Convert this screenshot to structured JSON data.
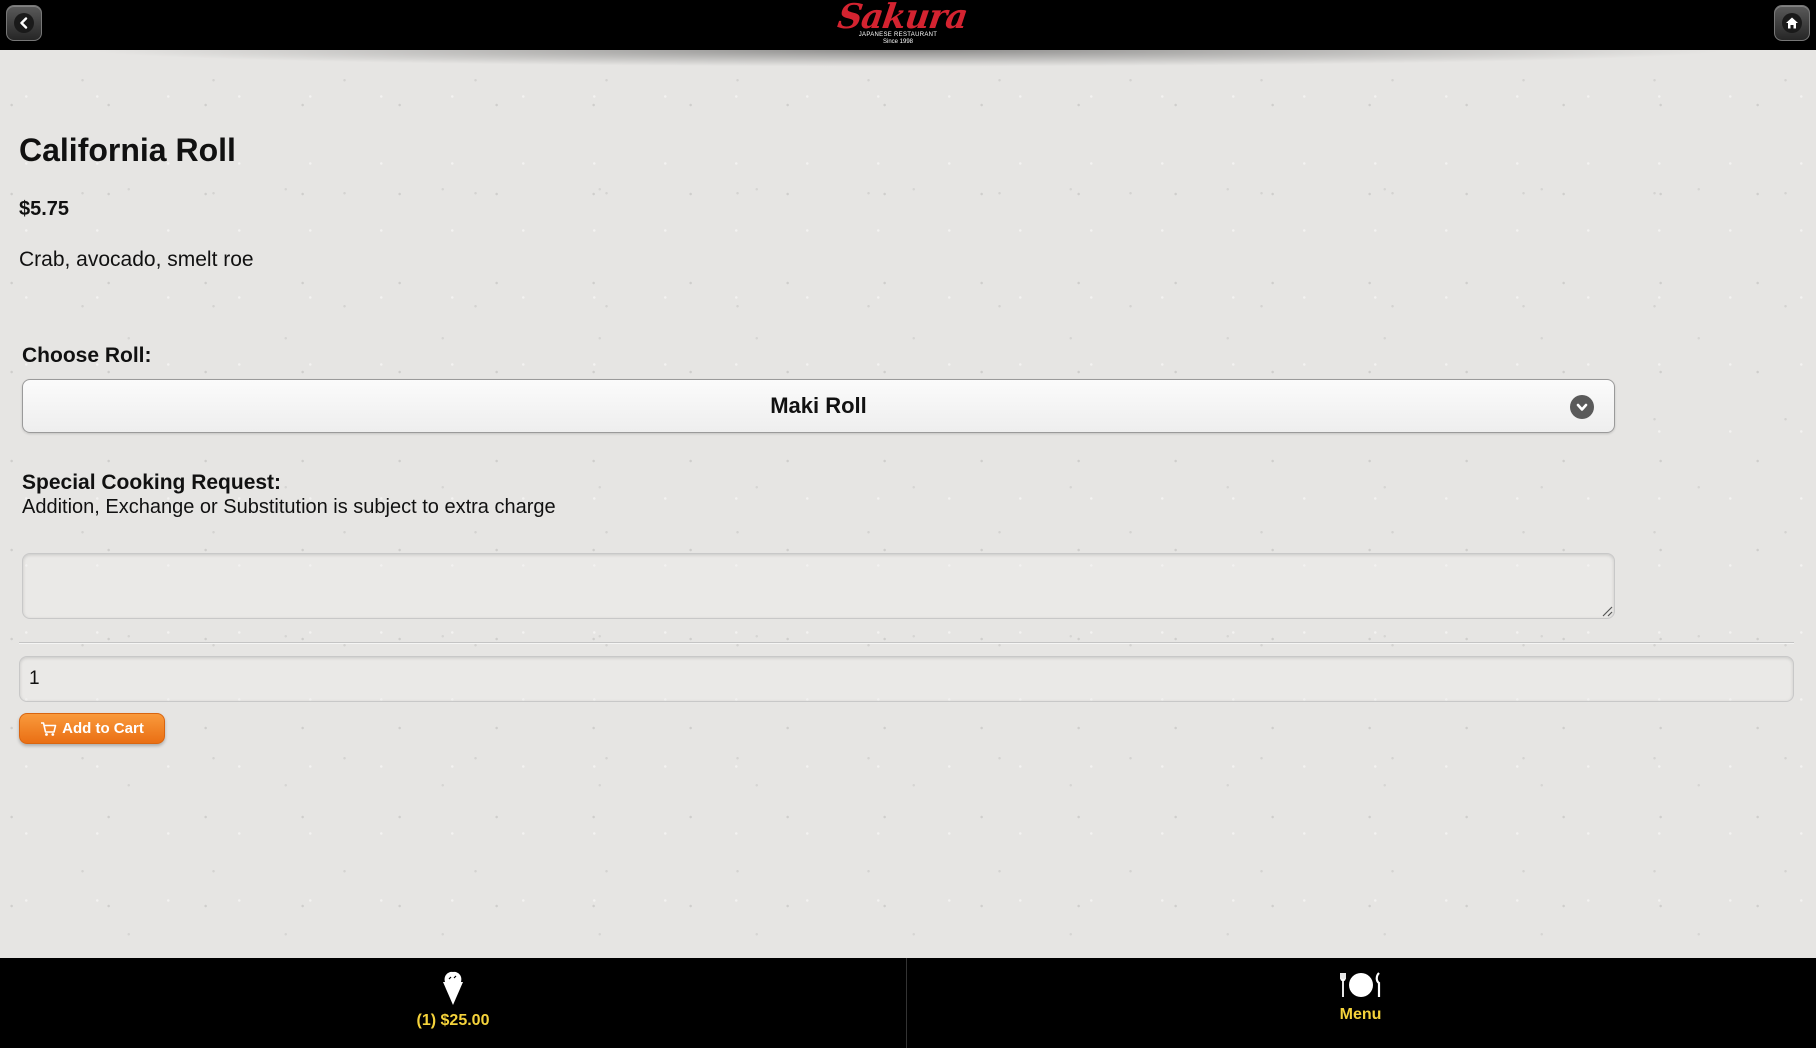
{
  "header": {
    "logo_text": "Sakura",
    "logo_subtitle": "JAPANESE RESTAURANT",
    "logo_since": "Since 1998",
    "back_icon": "chevron-left-icon",
    "home_icon": "home-icon"
  },
  "item": {
    "title": "California Roll",
    "price": "$5.75",
    "description": "Crab, avocado, smelt roe"
  },
  "options": {
    "choose_label": "Choose Roll:",
    "selected_roll": "Maki Roll"
  },
  "special_request": {
    "label": "Special Cooking Request:",
    "note": "Addition, Exchange or Substitution is subject to extra charge",
    "value": ""
  },
  "quantity": {
    "value": "1"
  },
  "cart_button": {
    "label": "Add to Cart"
  },
  "footer": {
    "cart_summary": "(1) $25.00",
    "menu_label": "Menu"
  },
  "colors": {
    "header_bg": "#000000",
    "accent_orange": "#ea6f14",
    "footer_text": "#f5d33b",
    "logo_red": "#d42330"
  }
}
